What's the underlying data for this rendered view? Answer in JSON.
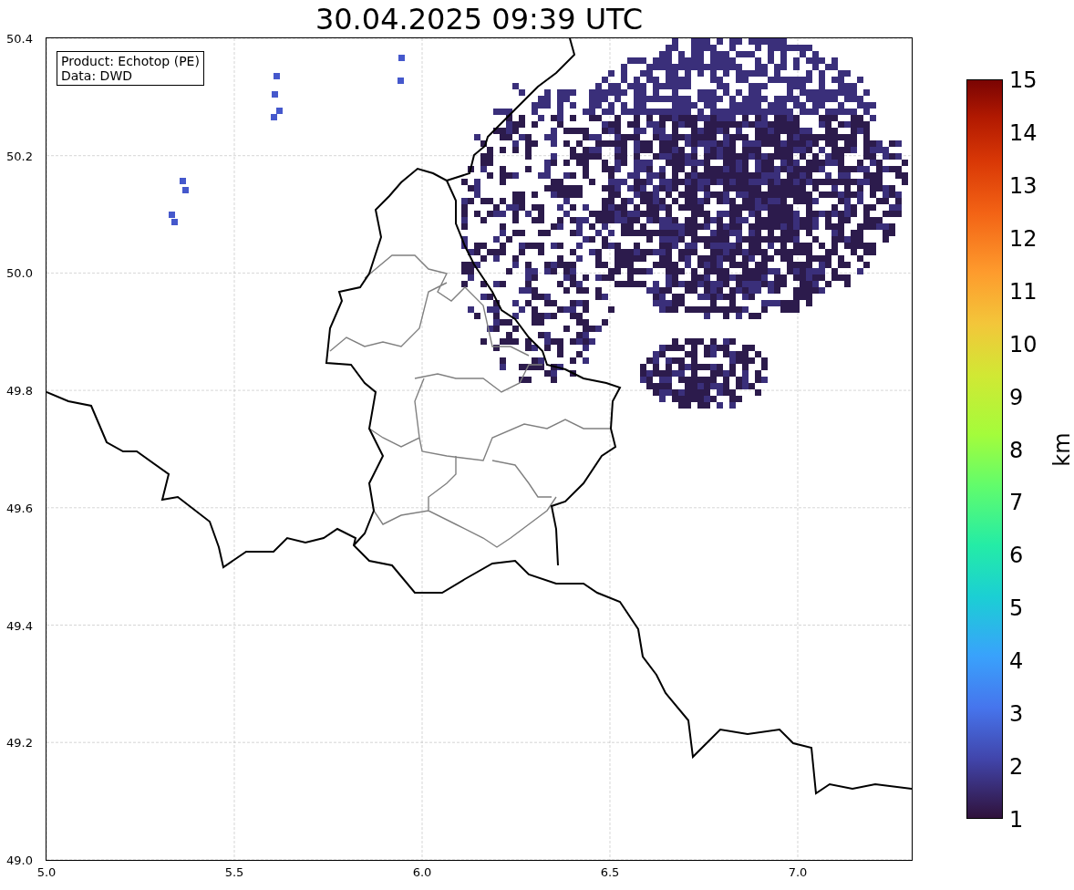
{
  "title": "30.04.2025 09:39 UTC",
  "info_box": {
    "lines": [
      "Product: Echotop (PE)",
      "Data: DWD"
    ]
  },
  "map": {
    "xticks": [
      "5.0",
      "5.5",
      "6.0",
      "6.5",
      "7.0"
    ],
    "yticks": [
      "50.4",
      "50.2",
      "50.0",
      "49.8",
      "49.6",
      "49.4",
      "49.2",
      "49.0"
    ]
  },
  "colorbar": {
    "label": "km",
    "ticks": [
      "15",
      "14",
      "13",
      "12",
      "11",
      "10",
      "9",
      "8",
      "7",
      "6",
      "5",
      "4",
      "3",
      "2",
      "1"
    ]
  }
}
